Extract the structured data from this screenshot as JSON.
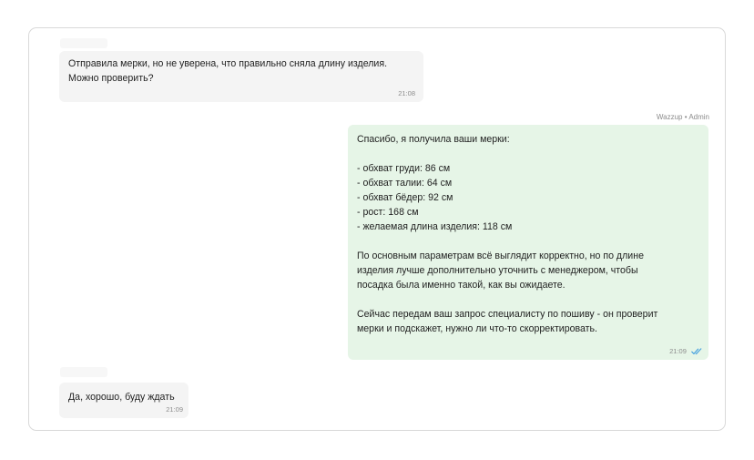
{
  "chat": {
    "messages": [
      {
        "direction": "incoming",
        "lines": [
          "Отправила мерки, но не уверена, что правильно сняла длину изделия.",
          "Можно проверить?"
        ],
        "time": "21:08"
      },
      {
        "direction": "outgoing",
        "author": "Wazzup • Admin",
        "lines": [
          "Спасибо, я получила ваши мерки:",
          "",
          "- обхват груди: 86 см",
          "- обхват талии: 64 см",
          "- обхват бёдер: 92 см",
          "- рост: 168 см",
          "- желаемая длина изделия: 118 см",
          "",
          "По основным параметрам всё выглядит корректно, но по длине",
          "изделия лучше дополнительно уточнить с менеджером, чтобы",
          "посадка была именно такой, как вы ожидаете.",
          "",
          "Сейчас передам ваш запрос специалисту по пошиву - он проверит",
          "мерки и подскажет, нужно ли что-то скорректировать."
        ],
        "time": "21:09",
        "status_icon": "double-check-icon"
      },
      {
        "direction": "incoming",
        "lines": [
          "Да, хорошо, буду ждать"
        ],
        "time": "21:09"
      }
    ]
  },
  "colors": {
    "incoming_bubble": "#f4f4f4",
    "outgoing_bubble": "#e6f5e7",
    "read_check": "#4aa3df",
    "timestamp": "#8c8c8c"
  }
}
